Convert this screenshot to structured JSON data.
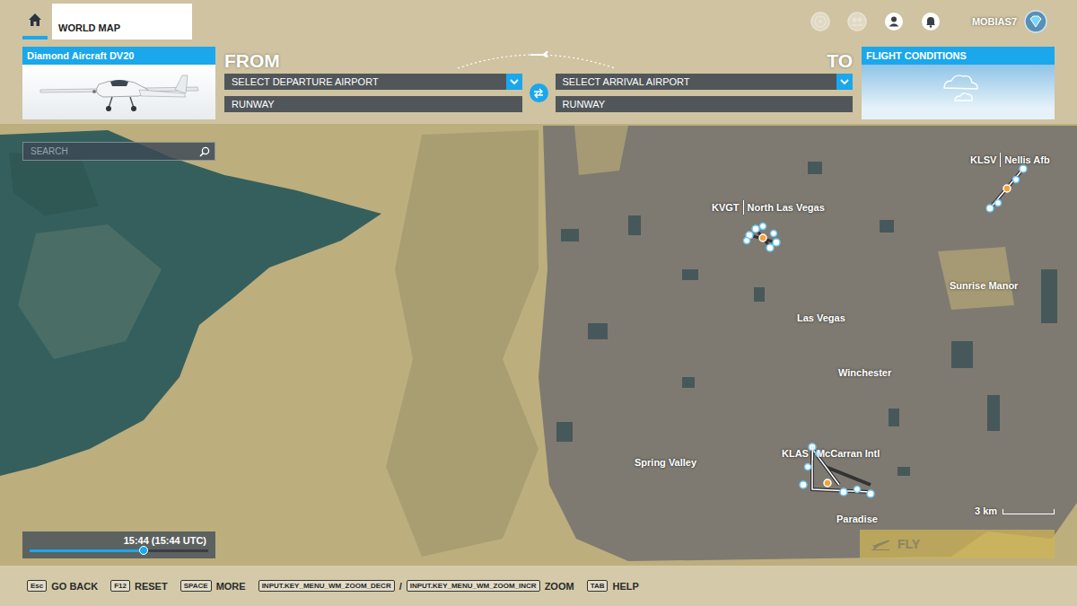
{
  "header": {
    "tab": "WORLD MAP",
    "user": "MOBIAS7"
  },
  "aircraft": {
    "name": "Diamond Aircraft DV20"
  },
  "route": {
    "from_label": "FROM",
    "to_label": "TO",
    "departure": {
      "airport": "SELECT DEPARTURE AIRPORT",
      "runway": "RUNWAY"
    },
    "arrival": {
      "airport": "SELECT ARRIVAL AIRPORT",
      "runway": "RUNWAY"
    }
  },
  "flight_conditions": {
    "title": "FLIGHT CONDITIONS"
  },
  "search": {
    "placeholder": "SEARCH"
  },
  "map": {
    "airports": [
      {
        "code": "KVGT",
        "name": "North Las Vegas"
      },
      {
        "code": "KLSV",
        "name": "Nellis Afb"
      },
      {
        "code": "KLAS",
        "name": "McCarran Intl"
      }
    ],
    "places": [
      "Sunrise Manor",
      "Las Vegas",
      "Winchester",
      "Spring Valley",
      "Paradise"
    ],
    "scale": "3 km"
  },
  "time": {
    "reading": "15:44 (15:44 UTC)",
    "level": 0.64
  },
  "fly_button": {
    "label": "FLY",
    "disabled": true
  },
  "hints": [
    {
      "keys": [
        "Esc"
      ],
      "label": "GO BACK"
    },
    {
      "keys": [
        "F12"
      ],
      "label": "RESET"
    },
    {
      "keys": [
        "SPACE"
      ],
      "label": "MORE"
    },
    {
      "keys": [
        "INPUT.KEY_MENU_WM_ZOOM_DECR",
        "INPUT.KEY_MENU_WM_ZOOM_INCR"
      ],
      "separator": "/",
      "label": "ZOOM"
    },
    {
      "keys": [
        "TAB"
      ],
      "label": "HELP"
    }
  ]
}
